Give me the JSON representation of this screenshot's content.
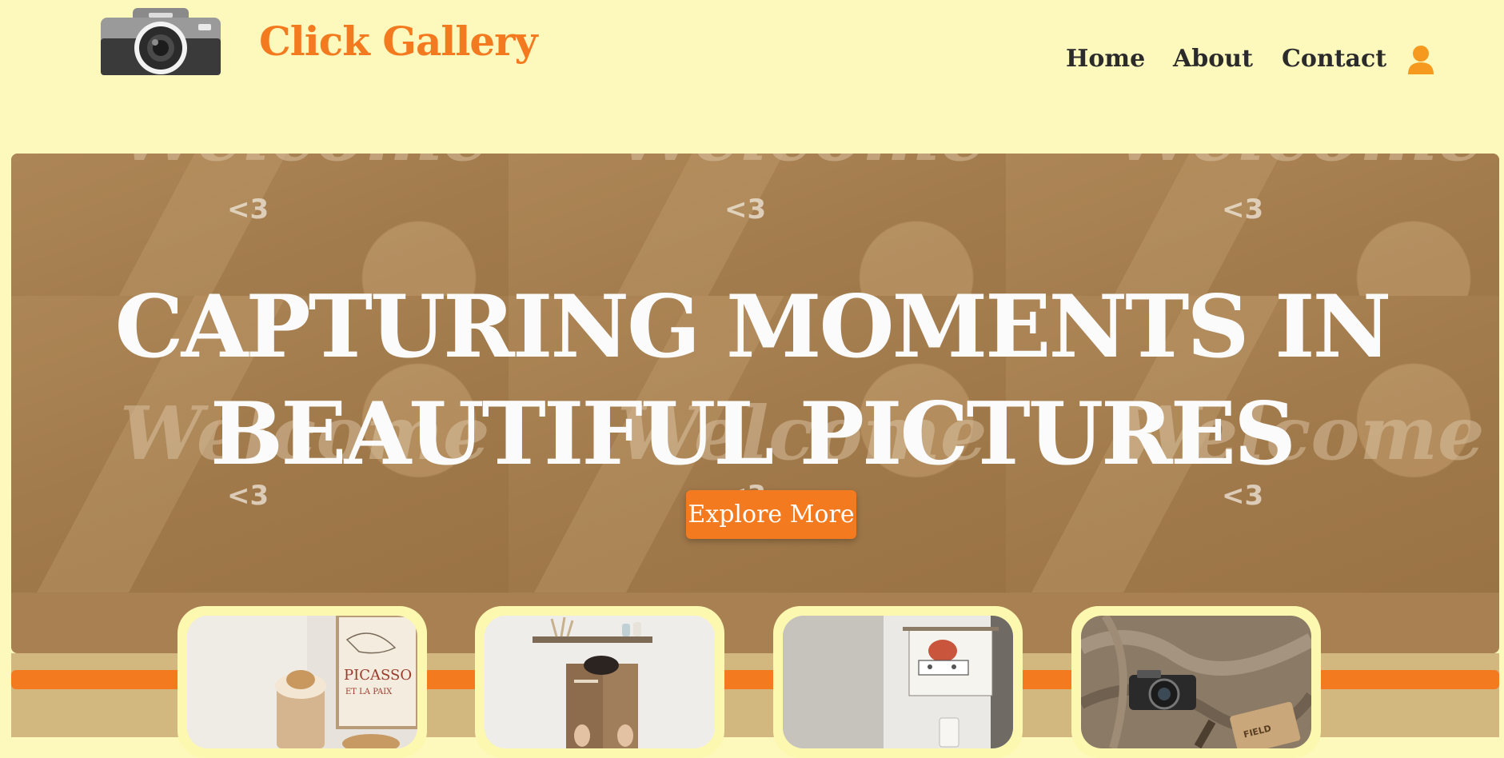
{
  "header": {
    "brand": "Click Gallery",
    "nav": [
      {
        "label": "Home"
      },
      {
        "label": "About"
      },
      {
        "label": "Contact"
      }
    ]
  },
  "hero": {
    "headline_line1": "CAPTURING MOMENTS IN",
    "headline_line2": "BEAUTIFUL PICTURES",
    "button_label": "Explore More",
    "tile_text": "<3",
    "tile_watermark": "Welcome"
  },
  "colors": {
    "accent": "#f47a20",
    "background": "#fdf8bc",
    "nav_text": "#2b2b2b",
    "band": "#d2b77f"
  },
  "gallery": {
    "cards": [
      {
        "name": "latte-picasso-photo"
      },
      {
        "name": "book-reading-photo"
      },
      {
        "name": "wall-hanging-photo"
      },
      {
        "name": "camera-blanket-photo"
      }
    ]
  }
}
